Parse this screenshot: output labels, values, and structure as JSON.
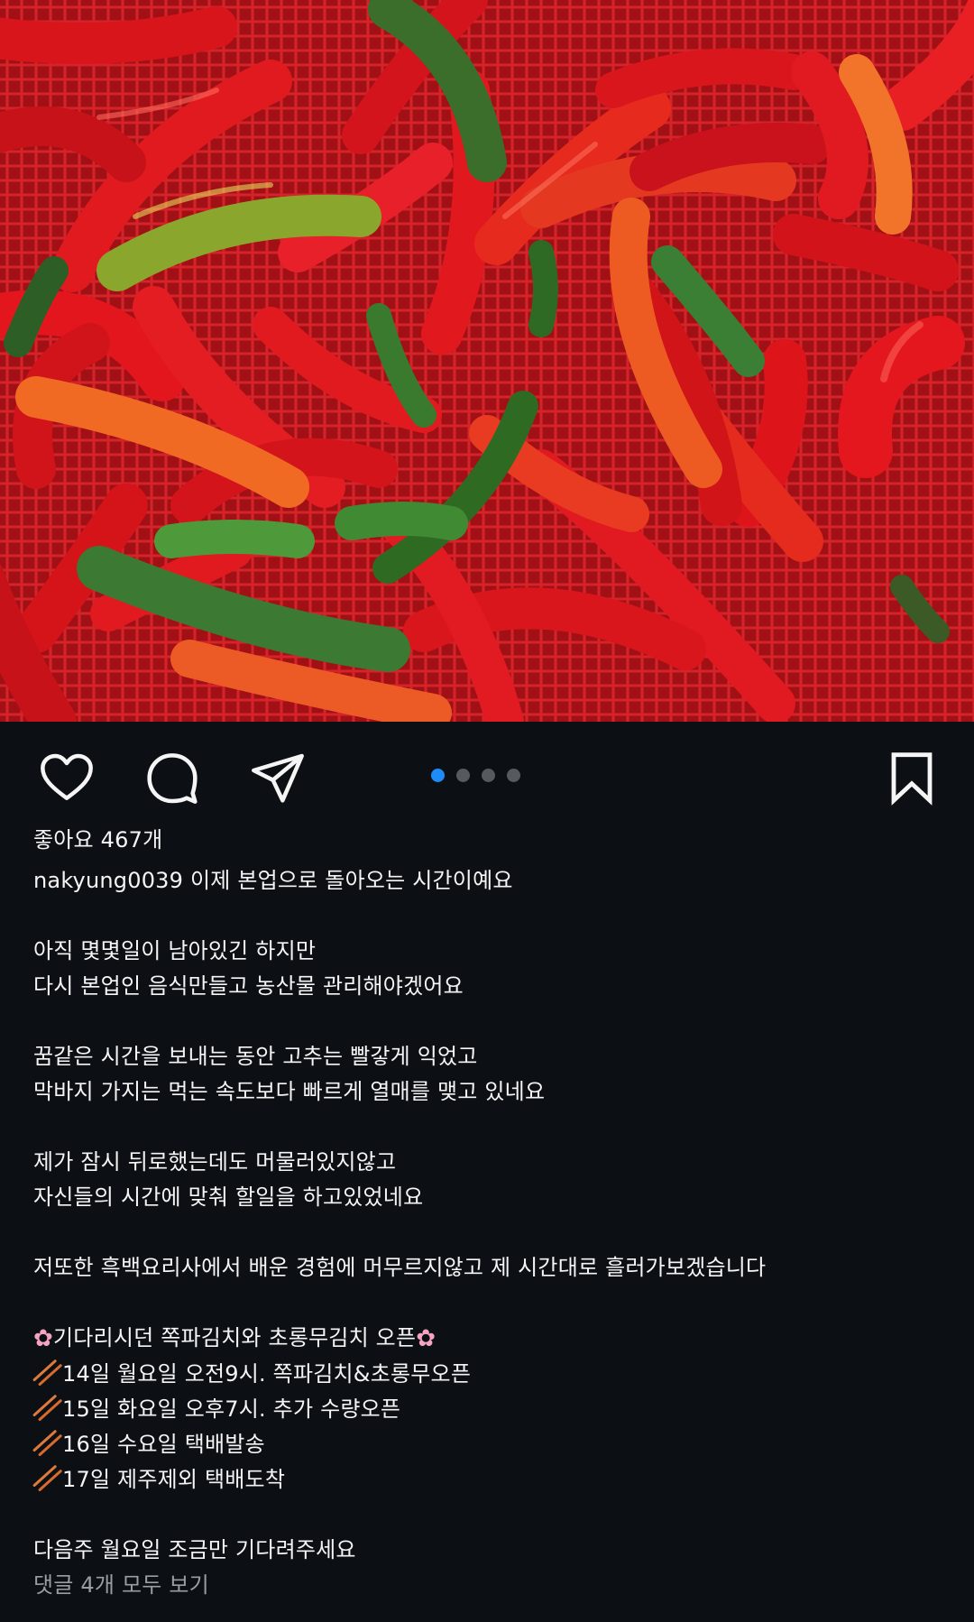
{
  "post": {
    "image_alt": "red chili peppers in a red basket",
    "carousel": {
      "count": 4,
      "active_index": 0
    },
    "likes_text": "좋아요 467개",
    "username": "nakyung0039",
    "caption_first": "이제 본업으로 돌아오는 시간이예요",
    "caption_lines": [
      "",
      "아직 몇몇일이 남아있긴 하지만",
      "다시 본업인 음식만들고 농산물 관리해야겠어요",
      "",
      "꿈같은 시간을 보내는 동안 고추는 빨갛게 익었고",
      "막바지 가지는 먹는 속도보다 빠르게 열매를 맺고 있네요",
      "",
      "제가 잠시 뒤로했는데도 머물러있지않고",
      "자신들의 시간에 맞춰 할일을 하고있었네요",
      "",
      "저또한 흑백요리사에서 배운 경험에 머무르지않고 제 시간대로 흘러가보겠습니다",
      ""
    ],
    "announcement": {
      "title": "기다리시던 쪽파김치와 초롱무김치 오픈",
      "items": [
        "14일 월요일 오전9시. 쪽파김치&초롱무오픈",
        "15일 화요일 오후7시. 추가 수량오픈",
        "16일 수요일 택배발송",
        "17일 제주제외 택배도착"
      ]
    },
    "closing": "다음주 월요일 조금만 기다려주세요",
    "comments_link": "댓글 4개 모두 보기"
  },
  "icons": {
    "like": "heart-icon",
    "comment": "comment-bubble-icon",
    "share": "paper-plane-icon",
    "save": "bookmark-icon",
    "flower": "cherry-blossom-icon",
    "bullet": "chopsticks-icon"
  },
  "colors": {
    "background": "#0c1014",
    "text": "#f5f5f5",
    "muted": "#9a9da1",
    "carousel_active": "#1d8cf8",
    "carousel_inactive": "#565a5f"
  }
}
